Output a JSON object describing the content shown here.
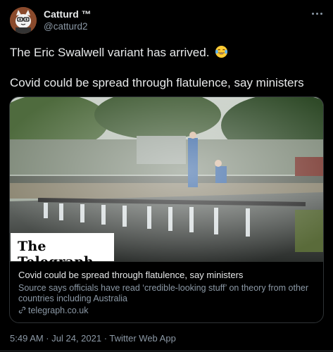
{
  "author": {
    "display_name": "Catturd ™",
    "handle": "@catturd2",
    "avatar_icon": "cartoon-cat-avatar"
  },
  "tweet": {
    "line1": "The Eric Swalwell variant has arrived.",
    "line1_emoji": "face-with-tears-of-joy",
    "line2": "Covid could be spread through flatulence, say ministers"
  },
  "card": {
    "logo_text": "The Telegraph",
    "title": "Covid could be spread through flatulence, say ministers",
    "description": "Source says officials have read ‘credible-looking stuff’ on theory from other countries including Australia",
    "domain": "telegraph.co.uk"
  },
  "meta": {
    "timestamp": "5:49 AM · Jul 24, 2021 · Twitter Web App"
  },
  "colors": {
    "background": "#000000",
    "text_primary": "#e7e9ea",
    "text_secondary": "#8b98a5",
    "border": "#2f3336"
  }
}
